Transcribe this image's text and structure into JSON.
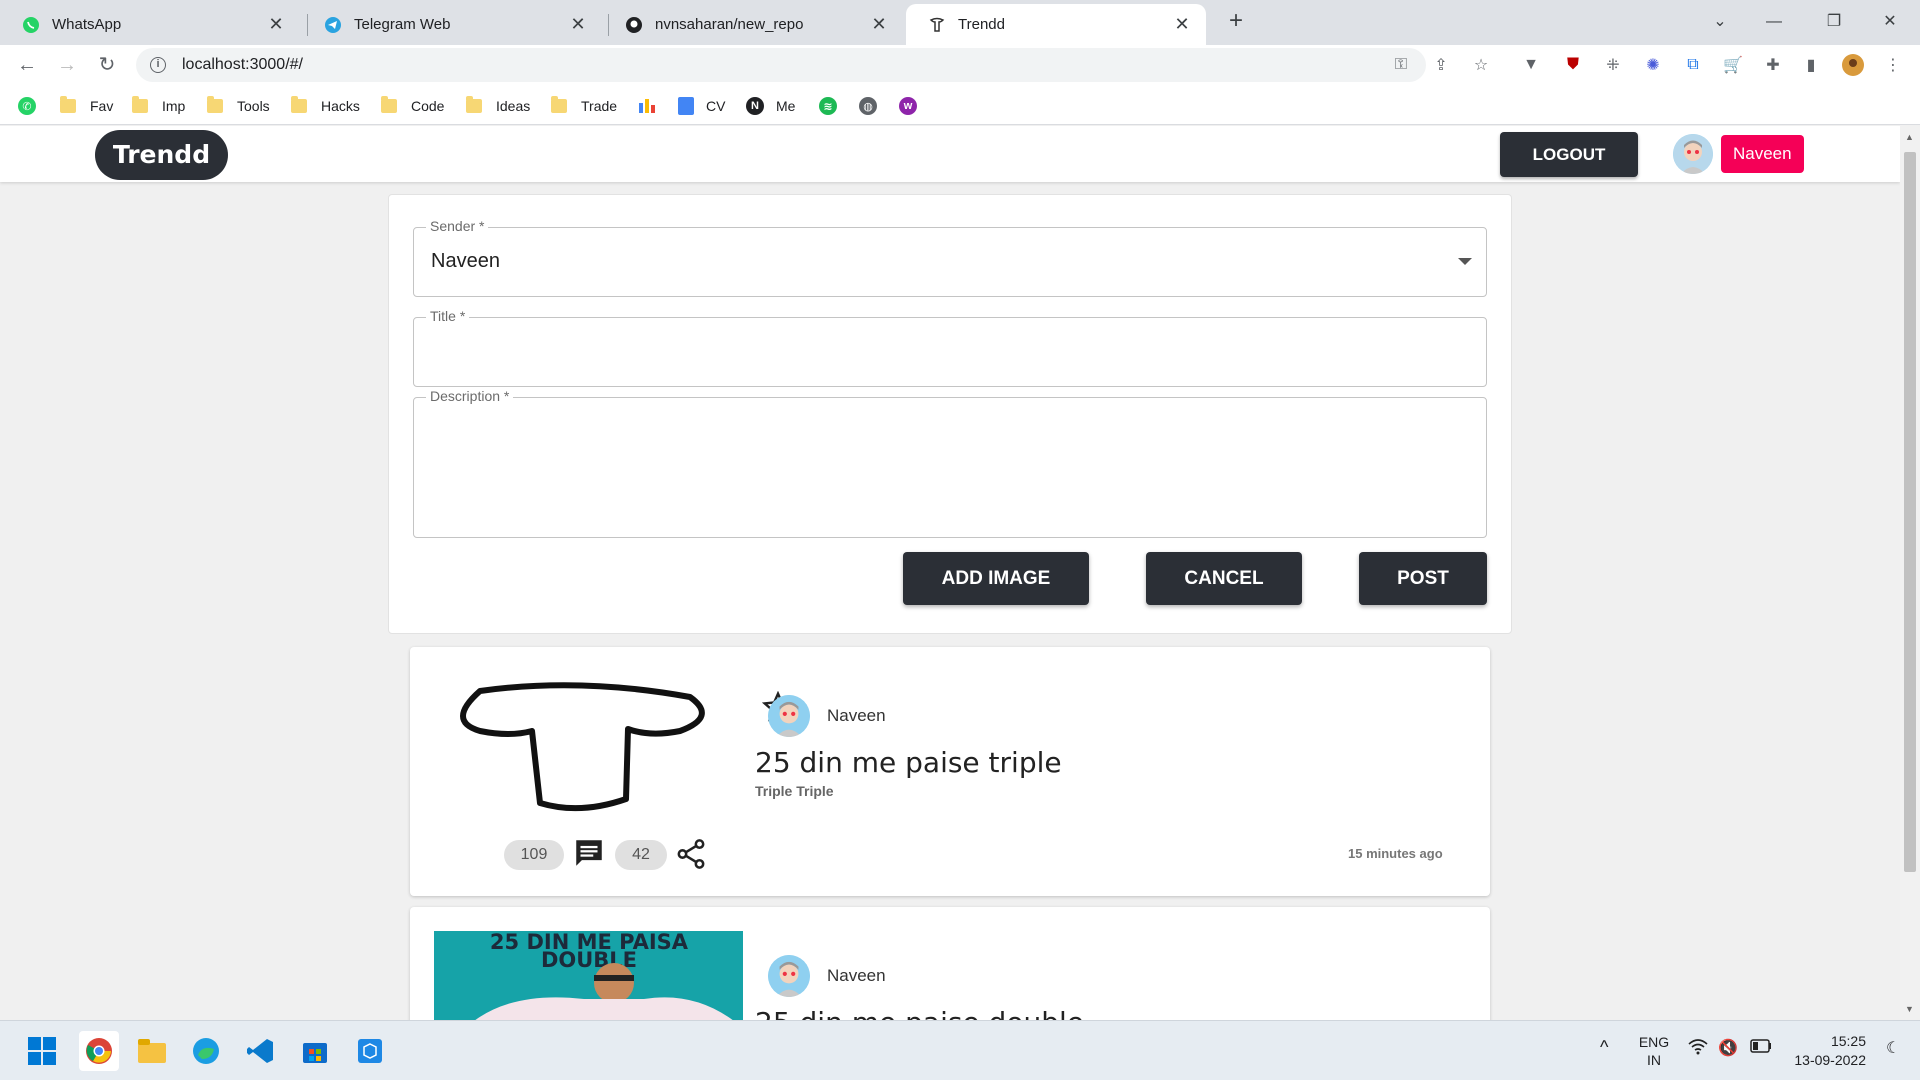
{
  "browser": {
    "tabs": [
      {
        "title": "WhatsApp",
        "icon": "whatsapp-icon"
      },
      {
        "title": "Telegram Web",
        "icon": "telegram-icon"
      },
      {
        "title": "nvnsaharan/new_repo",
        "icon": "github-icon"
      },
      {
        "title": "Trendd",
        "icon": "trendd-icon",
        "active": true
      }
    ],
    "url": "localhost:3000/#/",
    "bookmarks": [
      "Fav",
      "Imp",
      "Tools",
      "Hacks",
      "Code",
      "Ideas",
      "Trade",
      "CV",
      "Me"
    ]
  },
  "app": {
    "brand": "Trendd",
    "logout_label": "LOGOUT",
    "user_name": "Naveen"
  },
  "form": {
    "sender_label": "Sender *",
    "sender_value": "Naveen",
    "title_label": "Title *",
    "title_value": "",
    "description_label": "Description *",
    "description_value": "",
    "add_image_label": "ADD IMAGE",
    "cancel_label": "CANCEL",
    "post_label": "POST"
  },
  "posts": [
    {
      "author": "Naveen",
      "title": "25 din me paise triple",
      "description": "Triple Triple",
      "stars": "109",
      "comments": "42",
      "time": "15 minutes ago"
    },
    {
      "author": "Naveen",
      "title": "25 din me paise double",
      "image_text": "25 DIN ME PAISA DOUBLE"
    }
  ],
  "taskbar": {
    "lang": "ENG",
    "region": "IN",
    "time": "15:25",
    "date": "13-09-2022"
  },
  "colors": {
    "dark_button": "#2b2f36",
    "accent_pink": "#f50057",
    "post_image_bg": "#16a3a8"
  }
}
